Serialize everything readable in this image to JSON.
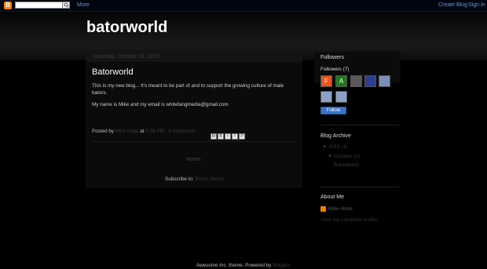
{
  "navbar": {
    "more_label": "More",
    "create_blog_label": "Create Blog",
    "sign_in_label": "Sign In",
    "logo_glyph": "B"
  },
  "header": {
    "blog_title": "batorworld"
  },
  "post": {
    "date_header": "Saturday, October 31, 2015",
    "title": "Batorworld",
    "body": [
      "This is my new blog... It's meant to be part of and to support the growing culture of male bators.",
      "My name is Mike and my email is whitefangmedia@gmail.com"
    ],
    "footer": {
      "posted_by_label": "Posted by",
      "author": "Mike Hotel",
      "at_label": "at",
      "time": "5:28 PM",
      "comments": "4 comments:",
      "share_icons": [
        "email-icon",
        "blogthis-icon",
        "twitter-icon",
        "facebook-icon",
        "pinterest-icon"
      ]
    }
  },
  "blog_pager": {
    "home_label": "Home"
  },
  "subscribe": {
    "label": "Subscribe to:",
    "link": "Posts (Atom)"
  },
  "sidebar": {
    "followers": {
      "title": "Followers",
      "count_label": "Followers (7)",
      "avatars": [
        {
          "letter": "F",
          "color": "#e8541a"
        },
        {
          "letter": "A",
          "color": "#1f7a1f"
        },
        {
          "letter": "",
          "color": "#5a5a5a"
        },
        {
          "letter": "",
          "color": "#2a3f8f"
        },
        {
          "letter": "",
          "color": "#7b8fb8"
        },
        {
          "letter": "",
          "color": "#8ea0c8"
        },
        {
          "letter": "",
          "color": "#8ea0c8"
        }
      ],
      "follow_label": "Follow"
    },
    "archive": {
      "title": "Blog Archive",
      "year": "2015",
      "year_count": "(1)",
      "month": "October",
      "month_count": "(1)",
      "post": "Batorworld"
    },
    "about": {
      "title": "About Me",
      "name": "Mike Hotel",
      "profile_link": "View my complete profile"
    }
  },
  "footer": {
    "theme_text": "Awesome Inc. theme. Powered by",
    "powered_link": "Blogger."
  },
  "colors": {
    "link": "#6b93d0",
    "follow": "#3b73c8",
    "blogger_orange": "#f57d00"
  }
}
